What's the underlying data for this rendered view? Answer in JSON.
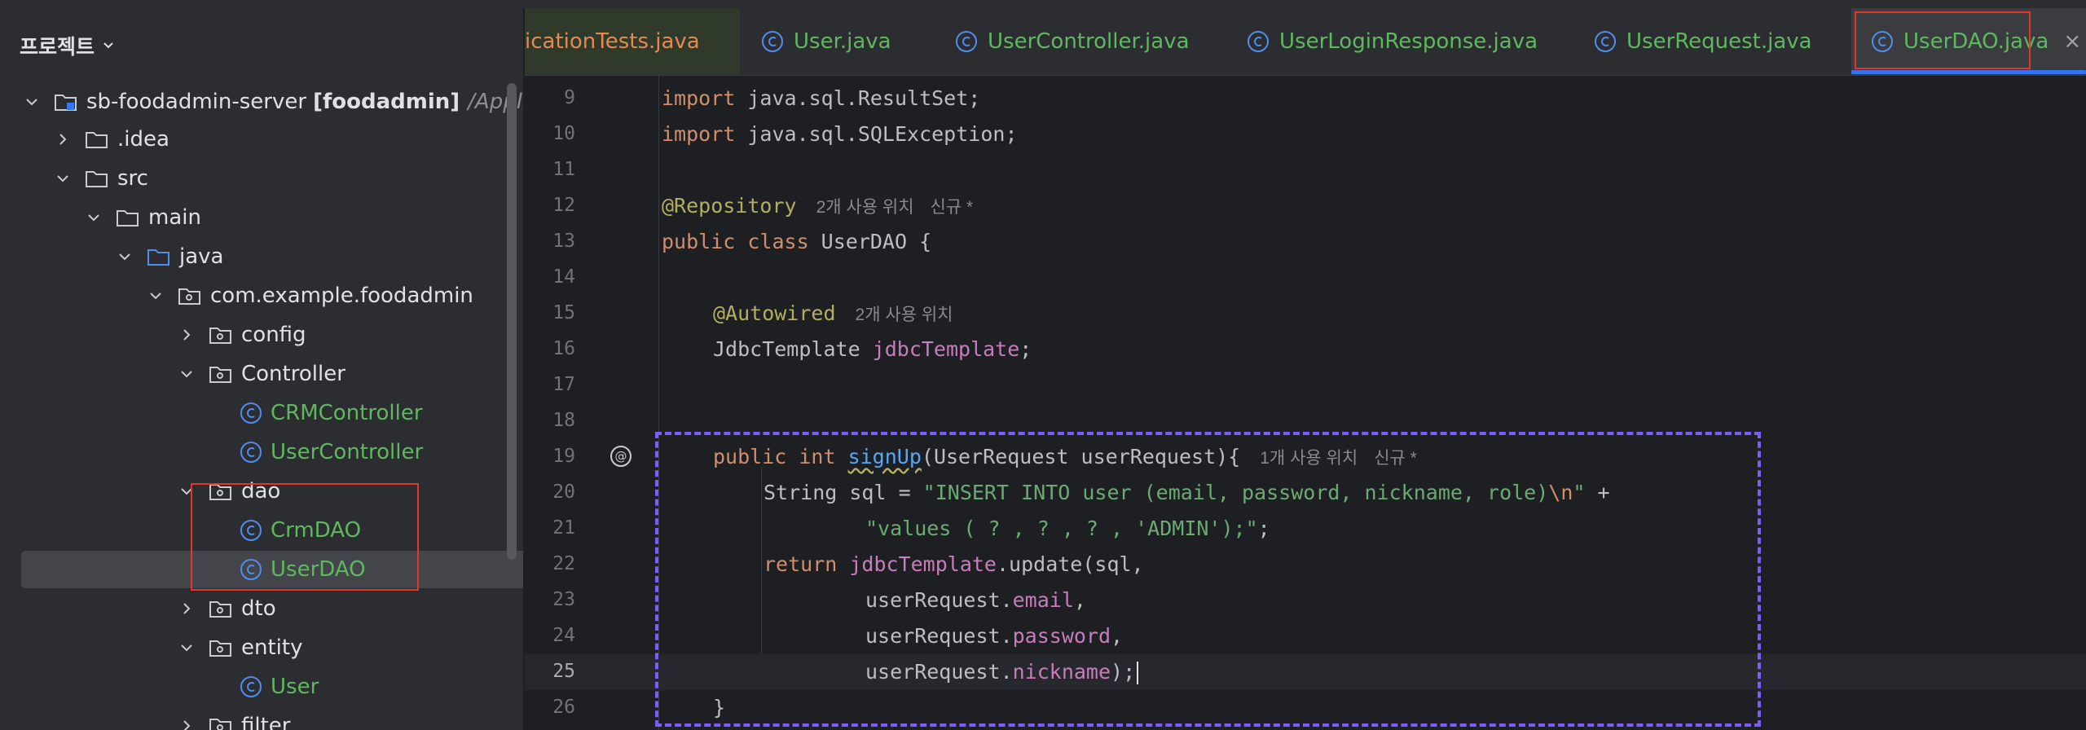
{
  "project_panel": {
    "title": "프로젝트",
    "root": {
      "name": "sb-foodadmin-server",
      "module": "[foodadmin]",
      "path": "/Applic"
    },
    "items": {
      "idea": ".idea",
      "src": "src",
      "main": "main",
      "java": "java",
      "package": "com.example.foodadmin",
      "config": "config",
      "controller": "Controller",
      "crm_controller": "CRMController",
      "user_controller": "UserController",
      "dao": "dao",
      "crm_dao": "CrmDAO",
      "user_dao": "UserDAO",
      "dto": "dto",
      "entity": "entity",
      "user": "User",
      "filter": "filter"
    }
  },
  "tabs": [
    {
      "label": "icationTests.java"
    },
    {
      "label": "User.java"
    },
    {
      "label": "UserController.java"
    },
    {
      "label": "UserLoginResponse.java"
    },
    {
      "label": "UserRequest.java"
    },
    {
      "label": "UserDAO.java",
      "active": true
    }
  ],
  "tab_close": "×",
  "editor": {
    "line_numbers": [
      "9",
      "10",
      "11",
      "12",
      "13",
      "14",
      "15",
      "16",
      "17",
      "18",
      "19",
      "20",
      "21",
      "22",
      "23",
      "24",
      "25",
      "26"
    ],
    "l9": [
      "import",
      " java.sql.ResultSet;"
    ],
    "l10": [
      "import",
      " java.sql.SQLException;"
    ],
    "l12": {
      "annotation": "@Repository",
      "hint1": "2개 사용 위치",
      "hint2": "신규 *"
    },
    "l13": [
      "public class",
      " UserDAO {"
    ],
    "l15": {
      "annotation": "@Autowired",
      "hint1": "2개 사용 위치"
    },
    "l16": {
      "type": "JdbcTemplate ",
      "field": "jdbcTemplate",
      "end": ";"
    },
    "l19": {
      "kw": "public int ",
      "fn": "signUp",
      "rest": "(UserRequest userRequest){",
      "hint1": "1개 사용 위치",
      "hint2": "신규 *"
    },
    "l20": {
      "plain": "String sql = ",
      "str": "\"INSERT INTO user (email, password, nickname, role)",
      "esc": "\\n",
      "str2": "\"",
      "end": " +"
    },
    "l21": {
      "str": "\"values ( ? , ? , ? , 'ADMIN');\"",
      "end": ";"
    },
    "l22": {
      "kw": "return ",
      "field": "jdbcTemplate",
      "rest": ".update(sql,"
    },
    "l23": {
      "obj": "userRequest.",
      "field": "email",
      "end": ","
    },
    "l24": {
      "obj": "userRequest.",
      "field": "password",
      "end": ","
    },
    "l25": {
      "obj": "userRequest.",
      "field": "nickname",
      "end": ");"
    },
    "l26": "}",
    "gutter_marker": "@"
  },
  "colors": {
    "background": "#1e1f22",
    "panel": "#2b2d30",
    "class_green": "#5fb85f",
    "keyword": "#cf8e6d",
    "string": "#6aab73",
    "field": "#c77dbb",
    "annotation_box_red": "#e0362c",
    "highlight_box_purple": "#7c5cff",
    "tab_underline": "#3574f0"
  }
}
